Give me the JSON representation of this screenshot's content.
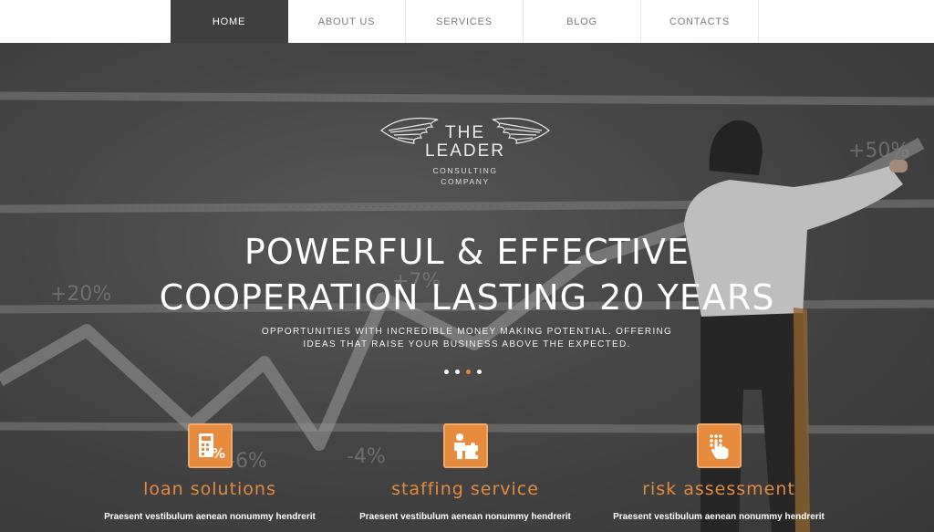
{
  "nav": {
    "items": [
      {
        "label": "HOME",
        "active": true
      },
      {
        "label": "ABOUT US",
        "active": false
      },
      {
        "label": "SERVICES",
        "active": false
      },
      {
        "label": "BLOG",
        "active": false
      },
      {
        "label": "CONTACTS",
        "active": false
      }
    ]
  },
  "logo": {
    "line1": "THE",
    "line2": "LEADER",
    "sub1": "CONSULTING",
    "sub2": "COMPANY",
    "icon": "wings-icon"
  },
  "hero": {
    "headline1": "POWERFUL & EFFECTIVE",
    "headline2": "COOPERATION LASTING 20 YEARS",
    "subline1": "OPPORTUNITIES WITH INCREDIBLE MONEY MAKING POTENTIAL. OFFERING",
    "subline2": "IDEAS THAT RAISE YOUR BUSINESS ABOVE THE EXPECTED.",
    "slides": 4,
    "active_slide": 3
  },
  "features": [
    {
      "title": "loan solutions",
      "icon": "calculator-percent-icon",
      "text": "Praesent vestibulum aenean nonummy hendrerit"
    },
    {
      "title": "staffing service",
      "icon": "person-puzzle-icon",
      "text": "Praesent vestibulum aenean nonummy hendrerit"
    },
    {
      "title": "risk assessment",
      "icon": "hand-touch-icon",
      "text": "Praesent vestibulum aenean nonummy hendrerit"
    }
  ],
  "colors": {
    "accent": "#e68b3e",
    "nav_active": "#3f3f3f",
    "hero_bg": "#555555"
  }
}
